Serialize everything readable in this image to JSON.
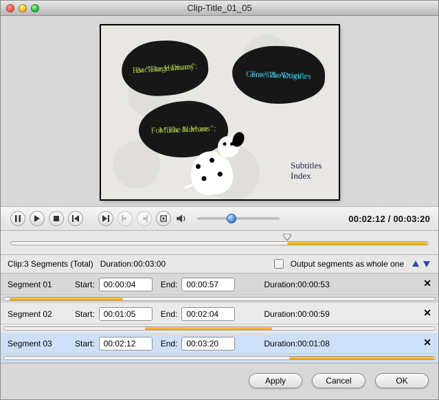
{
  "window": {
    "title": "Clip-Title_01_05"
  },
  "preview": {
    "blobA": {
      "line1": "For \"The Humans\":",
      "line2": "Backstage Disney"
    },
    "blobB": {
      "line1": "For \"The Dogs\":",
      "line2": "Games & Activities"
    },
    "blobC": {
      "line1": "For \"The Humans\":",
      "line2": "Music & More"
    },
    "subtitles": "Subtitles",
    "index": "Index"
  },
  "playback": {
    "current": "00:02:12",
    "total": "00:03:20",
    "volume_percent": 36,
    "master_fill_left_percent": 66,
    "master_fill_right_percent": 1
  },
  "volume": {
    "knob_left_percent": 36
  },
  "info": {
    "clip_label": "Clip:3 Segments (Total)",
    "duration_label": "Duration:00:03:00",
    "checkbox_label": "Output segments as whole one"
  },
  "segments": [
    {
      "name": "Segment 01",
      "start_label": "Start:",
      "start": "00:00:04",
      "end_label": "End:",
      "end": "00:00:57",
      "duration_label": "Duration:00:00:53",
      "fill_left_percent": 2,
      "fill_width_percent": 26
    },
    {
      "name": "Segment 02",
      "start_label": "Start:",
      "start": "00:01:05",
      "end_label": "End:",
      "end": "00:02:04",
      "duration_label": "Duration:00:00:59",
      "fill_left_percent": 33,
      "fill_width_percent": 29
    },
    {
      "name": "Segment 03",
      "start_label": "Start:",
      "start": "00:02:12",
      "end_label": "End:",
      "end": "00:03:20",
      "duration_label": "Duration:00:01:08",
      "fill_left_percent": 66,
      "fill_width_percent": 33
    }
  ],
  "buttons": {
    "apply": "Apply",
    "cancel": "Cancel",
    "ok": "OK"
  }
}
